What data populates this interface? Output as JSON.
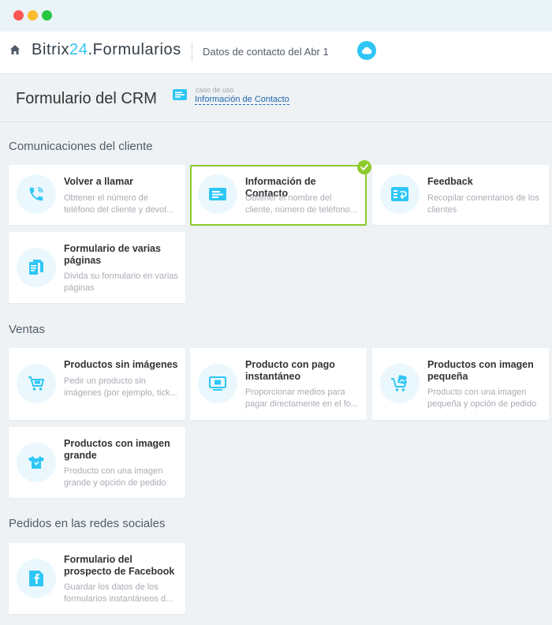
{
  "window": {
    "title": ""
  },
  "header": {
    "brand_prefix": "Bitrix",
    "brand_num": "24",
    "brand_suffix": ".Formularios",
    "subtitle": "Datos de contacto del Abr 1",
    "home_icon": "home-icon",
    "cloud_icon": "cloud-icon"
  },
  "page": {
    "title": "Formulario del CRM",
    "usecase_caption": "caso de uso",
    "usecase_link": "Información de Contacto"
  },
  "colors": {
    "accent": "#2fc6f6",
    "selected_border": "#8dcb2c",
    "link": "#2067b0"
  },
  "sections": [
    {
      "title": "Comunicaciones del cliente",
      "cards": [
        {
          "title": "Volver a llamar",
          "desc": "Obtener el número de teléfono del cliente y devol...",
          "icon": "phone-icon"
        },
        {
          "title": "Información de Contacto",
          "desc": "Obtener el nombre del cliente, número de teléfono...",
          "icon": "contact-card-icon",
          "selected": true
        },
        {
          "title": "Feedback",
          "desc": "Recopilar comentarios de los clientes",
          "icon": "feedback-icon"
        },
        {
          "title": "Formulario de varias páginas",
          "desc": "Divida su formulario en varias páginas",
          "icon": "multipage-icon"
        }
      ]
    },
    {
      "title": "Ventas",
      "cards": [
        {
          "title": "Productos sin imágenes",
          "desc": "Pedir un producto sin imágenes (por ejemplo, tick...",
          "icon": "cart-icon"
        },
        {
          "title": "Producto con pago instantáneo",
          "desc": "Proporcionar medios para pagar directamente en el fo...",
          "icon": "payment-icon"
        },
        {
          "title": "Productos con imagen pequeña",
          "desc": "Producto con una imagen pequeña y opción de pedido",
          "icon": "cart-image-icon"
        },
        {
          "title": "Productos con imagen grande",
          "desc": "Producto con una imagen grande y opción de pedido",
          "icon": "tshirt-icon"
        }
      ]
    },
    {
      "title": "Pedidos en las redes sociales",
      "cards": [
        {
          "title": "Formulario del prospecto de Facebook",
          "desc": "Guardar los datos de los formularios instantáneos d...",
          "icon": "facebook-icon"
        }
      ]
    }
  ]
}
